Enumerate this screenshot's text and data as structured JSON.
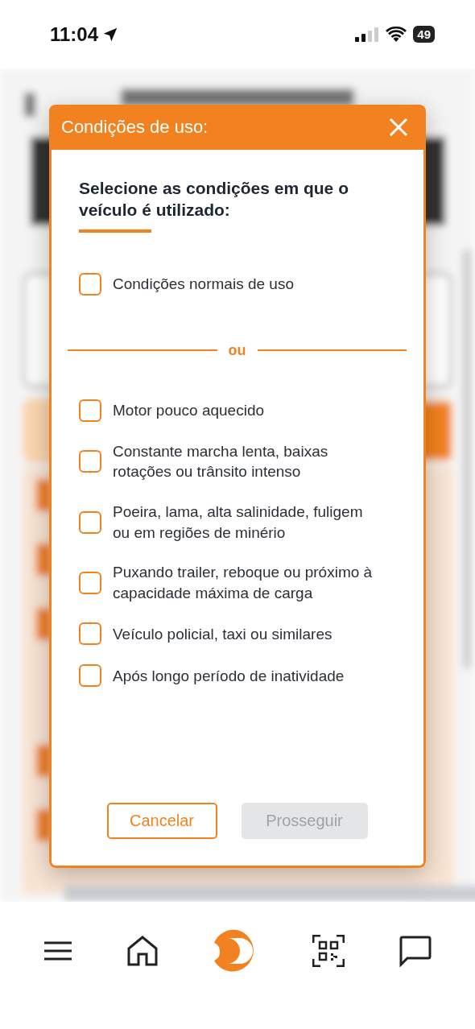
{
  "status_bar": {
    "time": "11:04",
    "battery": "49"
  },
  "modal": {
    "title": "Condições de uso:",
    "heading": "Selecione as condições em que o veículo é utilizado:",
    "options_before": [
      {
        "label": "Condições normais de uso",
        "checked": false
      }
    ],
    "separator": "ou",
    "options_after": [
      {
        "label": "Motor pouco aquecido",
        "checked": false
      },
      {
        "label": "Constante marcha lenta, baixas rotações ou trânsito intenso",
        "checked": false
      },
      {
        "label": "Poeira, lama, alta salinidade, fuligem ou em regiões de minério",
        "checked": false
      },
      {
        "label": "Puxando trailer, reboque ou próximo à capacidade máxima de carga",
        "checked": false
      },
      {
        "label": "Veículo policial, taxi ou similares",
        "checked": false
      },
      {
        "label": "Após longo período de inatividade",
        "checked": false
      }
    ],
    "buttons": [
      {
        "label": "Cancelar",
        "kind": "outline",
        "disabled": false
      },
      {
        "label": "Prosseguir",
        "kind": "primary",
        "disabled": true
      }
    ]
  }
}
